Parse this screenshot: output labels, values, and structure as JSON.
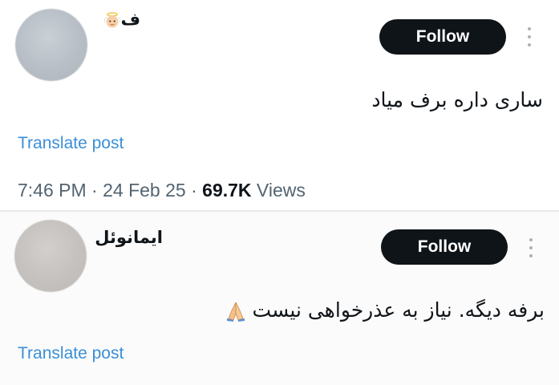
{
  "posts": [
    {
      "author_name": "ف",
      "author_emoji": "baby-angel-emoji",
      "follow_label": "Follow",
      "text": "ساری داره برف میاد",
      "translate_label": "Translate post",
      "time": "7:46 PM",
      "date": "24 Feb 25",
      "views_count": "69.7K",
      "views_label": "Views"
    },
    {
      "author_name": "ایمانوئل",
      "follow_label": "Follow",
      "text": "برفه دیگه. نیاز به عذرخواهی نیست",
      "text_emoji": "folded-hands-emoji",
      "translate_label": "Translate post"
    }
  ],
  "separator": "·",
  "colors": {
    "follow_bg": "#0f1419",
    "follow_text": "#ffffff",
    "link": "#3b8fd6",
    "meta": "#536471",
    "text": "#0f1419"
  }
}
